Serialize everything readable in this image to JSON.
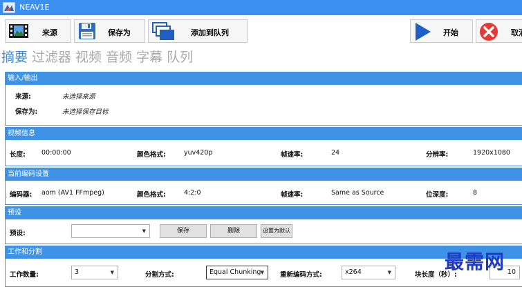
{
  "window": {
    "title": "NEAV1E"
  },
  "toolbar": {
    "source": "来源",
    "save_as": "保存为",
    "add_queue": "添加到队列",
    "start": "开始",
    "cancel": "取消"
  },
  "tabs": [
    "摘要",
    "过滤器",
    "视频",
    "音频",
    "字幕",
    "队列"
  ],
  "io": {
    "header": "输入/输出",
    "source_label": "来源:",
    "source_value": "未选择来源",
    "saveas_label": "保存为:",
    "saveas_value": "未选择保存目标"
  },
  "video_info": {
    "header": "视频信息",
    "length_label": "长度:",
    "length_value": "00:00:00",
    "color_label": "颜色格式:",
    "color_value": "yuv420p",
    "fps_label": "帧速率:",
    "fps_value": "24",
    "res_label": "分辨率:",
    "res_value": "1920x1080"
  },
  "encode": {
    "header": "当前编码设置",
    "encoder_label": "编码器:",
    "encoder_value": "aom (AV1 FFmpeg)",
    "color_label": "颜色格式:",
    "color_value": "4:2:0",
    "fps_label": "帧速率:",
    "fps_value": "Same as Source",
    "depth_label": "位深度:",
    "depth_value": "8"
  },
  "preset": {
    "header": "预设",
    "label": "预设:",
    "select_value": "",
    "save_btn": "保存",
    "delete_btn": "删除",
    "default_btn": "设置为默认"
  },
  "work": {
    "header": "工作和分割",
    "workers_label": "工作数量:",
    "workers_value": "3",
    "split_label": "分割方式:",
    "split_value": "Equal Chunking",
    "reencode_label": "重新编码方式:",
    "reencode_value": "x264",
    "chunk_label": "块长度（秒）:",
    "chunk_value": "10"
  },
  "watermark": "最需网",
  "colors": {
    "titlebar": "#3b8ff0",
    "group_header": "#3e93e6",
    "tab_active": "#3d8ee8",
    "tab_inactive": "#a9a9a9"
  }
}
